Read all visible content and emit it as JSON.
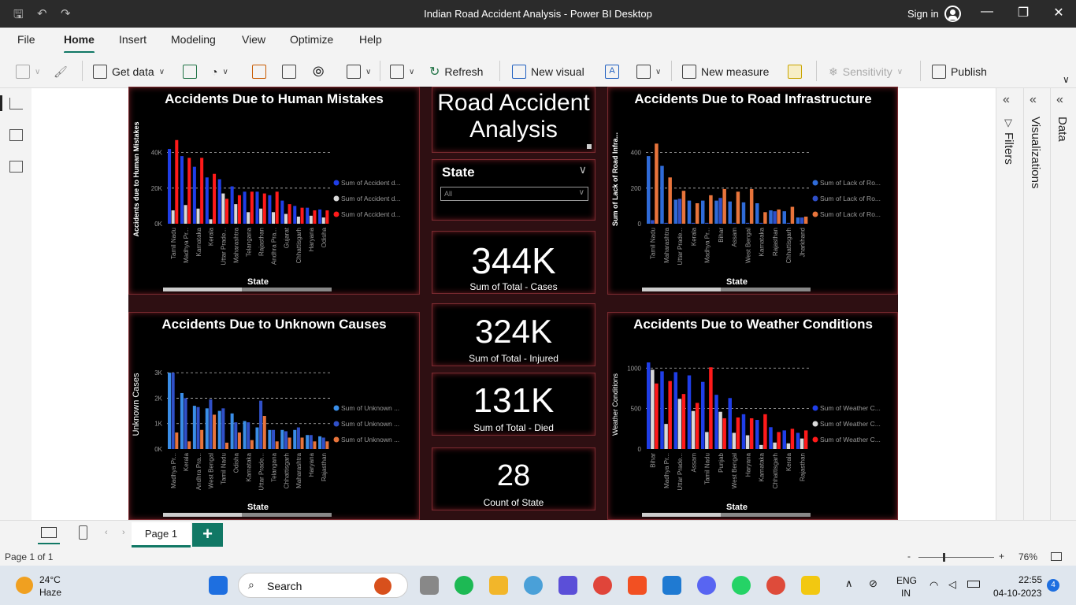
{
  "window": {
    "title": "Indian Road Accident Analysis - Power BI Desktop",
    "signin": "Sign in"
  },
  "menu": [
    "File",
    "Home",
    "Insert",
    "Modeling",
    "View",
    "Optimize",
    "Help"
  ],
  "ribbon": {
    "get_data": "Get data",
    "refresh": "Refresh",
    "new_visual": "New visual",
    "new_measure": "New measure",
    "sensitivity": "Sensitivity",
    "publish": "Publish"
  },
  "report": {
    "title": "Road Accident Analysis",
    "slicer": {
      "label": "State",
      "value": "All"
    },
    "cards": [
      {
        "value": "344K",
        "label": "Sum of Total - Cases"
      },
      {
        "value": "324K",
        "label": "Sum of Total - Injured"
      },
      {
        "value": "131K",
        "label": "Sum of Total - Died"
      },
      {
        "value": "28",
        "label": "Count of State"
      }
    ]
  },
  "chart_data": [
    {
      "type": "bar",
      "title": "Accidents Due to Human Mistakes",
      "xlabel": "State",
      "ylabel": "Accidents due to Human Mistakes",
      "ylim": [
        0,
        50000
      ],
      "yticks": [
        "0K",
        "20K",
        "40K"
      ],
      "ytick_values": [
        0,
        20000,
        40000
      ],
      "categories": [
        "Tamil Nadu",
        "Madhya Pr...",
        "Karnataka",
        "Kerala",
        "Uttar Prade...",
        "Maharashtra",
        "Telangana",
        "Rajasthan",
        "Andhra Pra...",
        "Gujarat",
        "Chhattisgarh",
        "Haryana",
        "Odisha"
      ],
      "legend": [
        "Sum of Accident d...",
        "Sum of Accident d...",
        "Sum of Accident d..."
      ],
      "colors": [
        "#1f3ee8",
        "#d9d9d9",
        "#ff1a1a"
      ],
      "series": [
        {
          "values": [
            42000,
            38000,
            32000,
            26000,
            25000,
            21000,
            18000,
            18000,
            16000,
            13000,
            10000,
            9000,
            8000
          ]
        },
        {
          "values": [
            7500,
            10500,
            8500,
            2500,
            17000,
            11000,
            6500,
            8500,
            6500,
            5500,
            4000,
            4500,
            3500
          ]
        },
        {
          "values": [
            47000,
            37000,
            37000,
            28000,
            14000,
            16000,
            18000,
            17000,
            18000,
            11000,
            9000,
            7500,
            7500
          ]
        }
      ]
    },
    {
      "type": "bar",
      "title": "Accidents Due to Road Infrastructure",
      "xlabel": "State",
      "ylabel": "Sum of Lack of Road Infra...",
      "ylim": [
        0,
        500
      ],
      "yticks": [
        "0",
        "200",
        "400"
      ],
      "ytick_values": [
        0,
        200,
        400
      ],
      "categories": [
        "Tamil Nadu",
        "Maharashtra",
        "Uttar Prade...",
        "Kerala",
        "Madhya Pr...",
        "Bihar",
        "Assam",
        "West Bengal",
        "Karnataka",
        "Rajasthan",
        "Chhattisgarh",
        "Jharkhand"
      ],
      "legend": [
        "Sum of Lack of Ro...",
        "Sum of Lack of Ro...",
        "Sum of Lack of Ro..."
      ],
      "colors": [
        "#2f6bd8",
        "#2f4fc8",
        "#e8743b"
      ],
      "series": [
        {
          "values": [
            380,
            325,
            135,
            130,
            130,
            130,
            125,
            120,
            115,
            75,
            70,
            35
          ]
        },
        {
          "values": [
            20,
            5,
            140,
            5,
            5,
            145,
            5,
            5,
            5,
            70,
            5,
            35
          ]
        },
        {
          "values": [
            450,
            260,
            185,
            115,
            160,
            195,
            180,
            195,
            65,
            80,
            95,
            40
          ]
        }
      ]
    },
    {
      "type": "bar",
      "title": "Accidents Due to Unknown Causes",
      "xlabel": "State",
      "ylabel": "Unknown Cases",
      "ylim": [
        0,
        3500
      ],
      "yticks": [
        "0K",
        "1K",
        "2K",
        "3K"
      ],
      "ytick_values": [
        0,
        1000,
        2000,
        3000
      ],
      "categories": [
        "Madhya Pr...",
        "Kerala",
        "Andhra Pra...",
        "West Bengal",
        "Tamil Nadu",
        "Odisha",
        "Karnataka",
        "Uttar Prade...",
        "Telangana",
        "Chhattisgarh",
        "Maharashtra",
        "Haryana",
        "Rajasthan"
      ],
      "legend": [
        "Sum of Unknown ...",
        "Sum of Unknown ...",
        "Sum of Unknown ..."
      ],
      "colors": [
        "#3a8ee8",
        "#3050c8",
        "#e8743b"
      ],
      "series": [
        {
          "values": [
            3000,
            2200,
            1700,
            1600,
            1500,
            1400,
            1100,
            850,
            750,
            750,
            750,
            550,
            500
          ]
        },
        {
          "values": [
            3000,
            2000,
            1650,
            1950,
            1600,
            1050,
            1050,
            1900,
            750,
            700,
            850,
            550,
            450
          ]
        },
        {
          "values": [
            650,
            300,
            750,
            1350,
            250,
            650,
            350,
            1300,
            300,
            450,
            450,
            300,
            300
          ]
        }
      ]
    },
    {
      "type": "bar",
      "title": "Accidents Due to Weather Conditions",
      "xlabel": "State",
      "ylabel": "Weather Conditions",
      "ylim": [
        0,
        1100
      ],
      "yticks": [
        "0",
        "500",
        "1000"
      ],
      "ytick_values": [
        0,
        500,
        1000
      ],
      "categories": [
        "Bihar",
        "Madhya Pr...",
        "Uttar Prade...",
        "Assam",
        "Tamil Nadu",
        "Punjab",
        "West Bengal",
        "Haryana",
        "Karnataka",
        "Chhattisgarh",
        "Kerala",
        "Rajasthan"
      ],
      "legend": [
        "Sum of Weather C...",
        "Sum of Weather C...",
        "Sum of Weather C..."
      ],
      "colors": [
        "#1f3ee8",
        "#d9d9d9",
        "#ff1a1a"
      ],
      "series": [
        {
          "values": [
            1070,
            960,
            950,
            910,
            830,
            670,
            630,
            430,
            360,
            270,
            230,
            200
          ]
        },
        {
          "values": [
            980,
            310,
            620,
            470,
            210,
            460,
            200,
            170,
            50,
            80,
            70,
            130
          ]
        },
        {
          "values": [
            810,
            840,
            680,
            570,
            1010,
            380,
            390,
            380,
            430,
            210,
            250,
            230
          ]
        }
      ]
    }
  ],
  "panes": {
    "filters": "Filters",
    "visualizations": "Visualizations",
    "data": "Data"
  },
  "pages": {
    "tab": "Page 1",
    "add": "+"
  },
  "status": {
    "page": "Page 1 of 1",
    "minus": "-",
    "plus": "+",
    "zoom": "76%"
  },
  "taskbar": {
    "weather_temp": "24°C",
    "weather_desc": "Haze",
    "search": "Search",
    "lang1": "ENG",
    "lang2": "IN",
    "time": "22:55",
    "date": "04-10-2023",
    "notif": "4"
  }
}
